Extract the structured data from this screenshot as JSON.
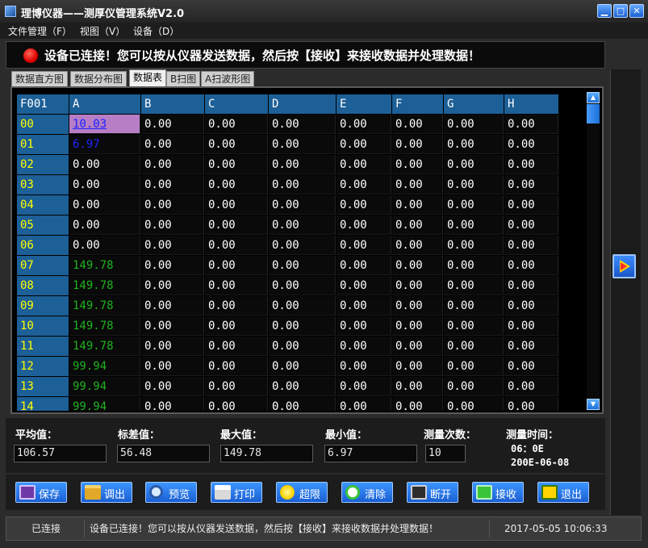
{
  "window": {
    "title": "理博仪器——测厚仪管理系统V2.0",
    "minimize": "▁",
    "maximize": "□",
    "close": "✕"
  },
  "menu": [
    "文件管理（F）",
    "视图（V）",
    "设备（D）"
  ],
  "banner": {
    "led_color": "#e00000",
    "text": "设备已连接！您可以按从仪器发送数据，然后按【接收】来接收数据并处理数据！"
  },
  "tabs": [
    {
      "label": "数据直方图",
      "active": false
    },
    {
      "label": "数据分布图",
      "active": false
    },
    {
      "label": "数据表",
      "active": true
    },
    {
      "label": "B扫图",
      "active": false
    },
    {
      "label": "A扫波形图",
      "active": false
    }
  ],
  "grid": {
    "corner": "F001",
    "columns": [
      "A",
      "B",
      "C",
      "D",
      "E",
      "F",
      "G",
      "H"
    ],
    "rows": [
      {
        "id": "00",
        "A": "10.03",
        "A_style": "selected",
        "rest": "0.00"
      },
      {
        "id": "01",
        "A": "6.97",
        "A_style": "blue",
        "rest": "0.00"
      },
      {
        "id": "02",
        "A": "0.00",
        "A_style": "normal",
        "rest": "0.00"
      },
      {
        "id": "03",
        "A": "0.00",
        "A_style": "normal",
        "rest": "0.00"
      },
      {
        "id": "04",
        "A": "0.00",
        "A_style": "normal",
        "rest": "0.00"
      },
      {
        "id": "05",
        "A": "0.00",
        "A_style": "normal",
        "rest": "0.00"
      },
      {
        "id": "06",
        "A": "0.00",
        "A_style": "normal",
        "rest": "0.00"
      },
      {
        "id": "07",
        "A": "149.78",
        "A_style": "green",
        "rest": "0.00"
      },
      {
        "id": "08",
        "A": "149.78",
        "A_style": "green",
        "rest": "0.00"
      },
      {
        "id": "09",
        "A": "149.78",
        "A_style": "green",
        "rest": "0.00"
      },
      {
        "id": "10",
        "A": "149.78",
        "A_style": "green",
        "rest": "0.00"
      },
      {
        "id": "11",
        "A": "149.78",
        "A_style": "green",
        "rest": "0.00"
      },
      {
        "id": "12",
        "A": "99.94",
        "A_style": "green",
        "rest": "0.00"
      },
      {
        "id": "13",
        "A": "99.94",
        "A_style": "green",
        "rest": "0.00"
      },
      {
        "id": "14",
        "A": "99.94",
        "A_style": "green",
        "rest": "0.00"
      }
    ],
    "scroll_up": "▲",
    "scroll_down": "▼"
  },
  "stats": {
    "avg_label": "平均值：",
    "avg": "106.57",
    "std_label": "标差值：",
    "std": "56.48",
    "max_label": "最大值：",
    "max": "149.78",
    "min_label": "最小值：",
    "min": "6.97",
    "count_label": "测量次数：",
    "count": "10",
    "time_label": "测量时间：",
    "time": "06：0E",
    "date": "200E-06-08"
  },
  "toolbar": [
    {
      "name": "save",
      "label": "保存",
      "icon": "save-icon",
      "color": "#6f3aa8"
    },
    {
      "name": "load",
      "label": "调出",
      "icon": "folder-icon",
      "color": "#e2a928"
    },
    {
      "name": "preview",
      "label": "预览",
      "icon": "magnifier-icon",
      "color": "#9fd4ff"
    },
    {
      "name": "print",
      "label": "打印",
      "icon": "printer-icon",
      "color": "#d9d9d9"
    },
    {
      "name": "limit",
      "label": "超限",
      "icon": "bulb-icon",
      "color": "#ffd400"
    },
    {
      "name": "clear",
      "label": "清除",
      "icon": "refresh-icon",
      "color": "#3ac43a"
    },
    {
      "name": "disconnect",
      "label": "断开",
      "icon": "computer-icon",
      "color": "#cfcfcf"
    },
    {
      "name": "receive",
      "label": "接收",
      "icon": "receive-icon",
      "color": "#3ac43a"
    },
    {
      "name": "exit",
      "label": "退出",
      "icon": "exit-icon",
      "color": "#ffd400"
    }
  ],
  "statusbar": {
    "conn": "已连接",
    "message": "设备已连接！您可以按从仪器发送数据，然后按【接收】来接收数据并处理数据！",
    "datetime": "2017-05-05 10:06:33"
  }
}
